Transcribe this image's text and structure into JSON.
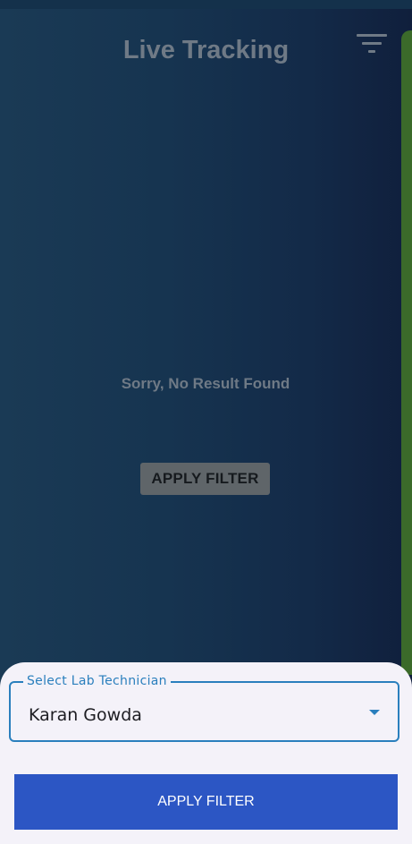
{
  "header": {
    "title": "Live Tracking",
    "filter_icon": "filter-list-icon"
  },
  "main": {
    "empty_message": "Sorry, No Result Found",
    "apply_filter_label": "APPLY FILTER"
  },
  "sheet": {
    "select_label": "Select Lab Technician",
    "select_value": "Karan Gowda",
    "dropdown_icon": "caret-down-icon",
    "apply_button_label": "APPLY FILTER"
  },
  "colors": {
    "accent": "#2a7fbd",
    "button": "#2c56c4"
  }
}
